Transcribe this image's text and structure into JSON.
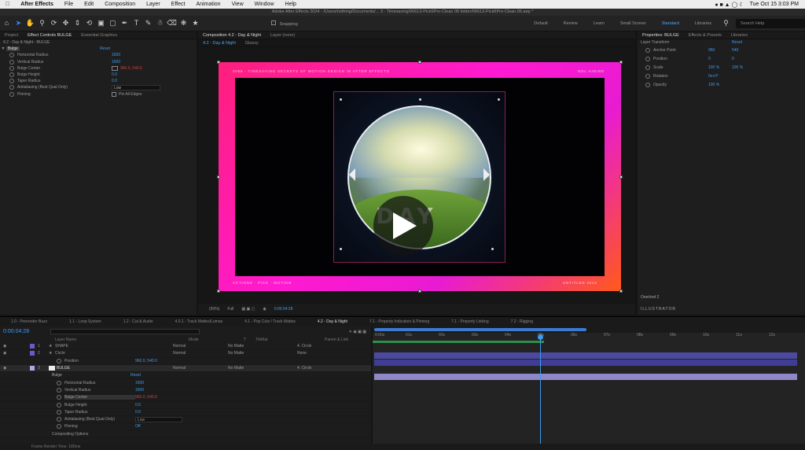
{
  "menubar": {
    "app": "After Effects",
    "items": [
      "File",
      "Edit",
      "Composition",
      "Layer",
      "Effect",
      "Animation",
      "View",
      "Window",
      "Help"
    ],
    "clock": "Tue Oct 15  3:03 PM"
  },
  "titlebar": {
    "text": "Adobe After Effects 2024 - /Users/nothing/Documents/... 3 - Timesaving/06613-Pick6Pro-Clean 06 folder/06613-Pick6Pro-Clean.06.aep *"
  },
  "toolbar": {
    "snapping": "Snapping",
    "workspaces": [
      "Default",
      "Review",
      "Learn",
      "Small Screen",
      "Standard",
      "Libraries"
    ],
    "active_workspace": "Standard",
    "search_placeholder": "Search Help"
  },
  "left_panel": {
    "tabs": [
      "Project",
      "Effect Controls BULGE",
      "Essential Graphics"
    ],
    "subtitle": "4.2 - Day & Night - BULGE",
    "effect": "Bulge",
    "props": [
      {
        "label": "Horizontal Radius",
        "value": "1600"
      },
      {
        "label": "Vertical Radius",
        "value": "1600"
      },
      {
        "label": "Bulge Center",
        "value": "960.0, 540.0"
      },
      {
        "label": "Bulge Height",
        "value": "0.0"
      },
      {
        "label": "Taper Radius",
        "value": "0.0"
      },
      {
        "label": "Antialiasing (Best Qual Only)",
        "value": "Low"
      },
      {
        "label": "Pinning",
        "value": "Pin All Edges"
      }
    ]
  },
  "comp_panel": {
    "tabs": [
      "Composition 4.2 - Day & Night",
      "Layer (none)"
    ],
    "breadcrumb": [
      "4.2 - Day & Night",
      "Glassy"
    ],
    "top_text": "0066 - TIMESAVING SECRETS OF MOTION DESIGN IN AFTER EFFECTS",
    "top_right": "NOL HIDING",
    "bottom_left": "ACTIONS · PICK · MOTION",
    "bottom_right": "UNTITLED 2024",
    "day_text": "DAY",
    "zoom": "(50%)",
    "res": "Full",
    "timecode": "0:00:04:28"
  },
  "right_panel": {
    "tabs": [
      "Properties: BULGE",
      "Effects & Presets",
      "Libraries"
    ],
    "section": "Layer Transform",
    "props": [
      {
        "label": "Anchor Point",
        "v1": "960",
        "v2": "540"
      },
      {
        "label": "Position",
        "v1": "0",
        "v2": "0"
      },
      {
        "label": "Scale",
        "v1": "100 %",
        "v2": "100 %"
      },
      {
        "label": "Rotation",
        "v1": "0x+0°",
        "v2": ""
      },
      {
        "label": "Opacity",
        "v1": "100 %",
        "v2": ""
      }
    ],
    "overlord": "Overlord 2",
    "illustrator": "ILLUSTRATOR"
  },
  "timeline": {
    "tabs": [
      "1.0 - Prerender Buzz",
      "1.1 - Loop System",
      "1.2 - Cut & Audio",
      "4.0.1 - Track Mattes/Lumas",
      "4.1 - Pop Cuts / Track Mattes",
      "4.2 - Day & Night",
      "7.1 - Property Indicators & Pinning",
      "7.1 - Property Linking",
      "7.2 - Rigging"
    ],
    "active_tab": "4.2 - Day & Night",
    "timecode": "0:00:04:28",
    "cols": [
      "Layer Name",
      "Mode",
      "T",
      "TrkMat",
      "Parent & Link"
    ],
    "layers": [
      {
        "num": "1",
        "name": "SHAPE",
        "mode": "Normal",
        "trk": "No Matte",
        "parent": "4. Circle"
      },
      {
        "num": "2",
        "name": "Circle",
        "mode": "Normal",
        "trk": "No Matte",
        "parent": "None"
      },
      {
        "num": "",
        "name": "Position",
        "mode": "",
        "trk": "",
        "parent": "960.0, 540.0"
      },
      {
        "num": "3",
        "name": "BULGE",
        "mode": "Normal",
        "trk": "No Matte",
        "parent": "4. Circle"
      }
    ],
    "effect_props": [
      {
        "label": "Bulge",
        "value": "Reset"
      },
      {
        "label": "Horizontal Radius",
        "value": "1600"
      },
      {
        "label": "Vertical Radius",
        "value": "1600"
      },
      {
        "label": "Bulge Center",
        "value": "960.0, 540.0"
      },
      {
        "label": "Bulge Height",
        "value": "0.0"
      },
      {
        "label": "Taper Radius",
        "value": "0.0"
      },
      {
        "label": "Antialiasing (Best Qual Only)",
        "value": "Low"
      },
      {
        "label": "Pinning",
        "value": "Off"
      },
      {
        "label": "Compositing Options",
        "value": ""
      }
    ],
    "ruler": [
      "0:00s",
      "01s",
      "02s",
      "03s",
      "04s",
      "05s",
      "06s",
      "07s",
      "08s",
      "09s",
      "10s",
      "11s",
      "12s"
    ],
    "status": "Frame Render Time: 180ms"
  }
}
